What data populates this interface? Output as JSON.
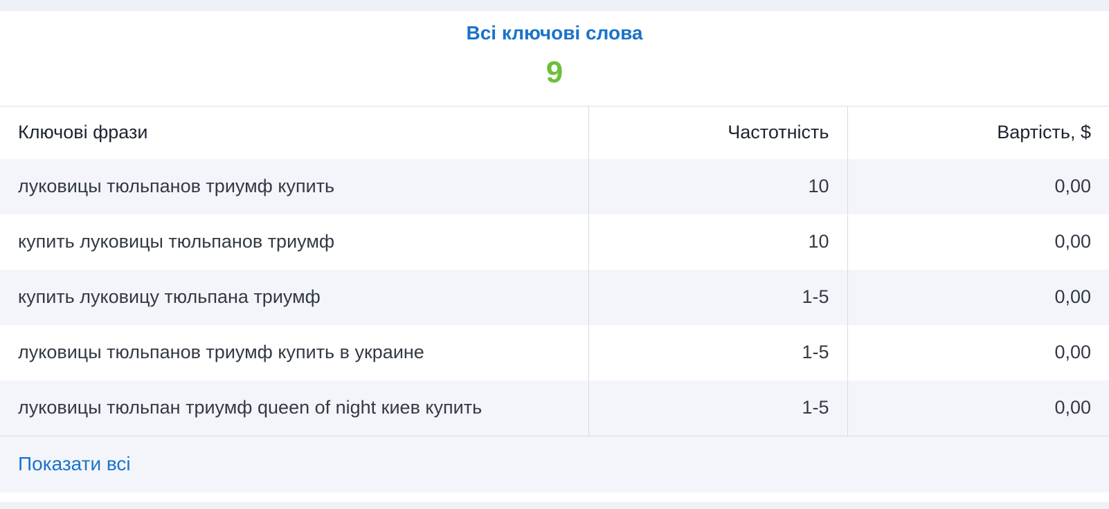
{
  "summary": {
    "title": "Всі ключові слова",
    "count": "9"
  },
  "table": {
    "headers": {
      "phrase": "Ключові фрази",
      "frequency": "Частотність",
      "cost": "Вартість, $"
    },
    "rows": [
      {
        "phrase": "луковицы тюльпанов триумф купить",
        "frequency": "10",
        "cost": "0,00"
      },
      {
        "phrase": "купить луковицы тюльпанов триумф",
        "frequency": "10",
        "cost": "0,00"
      },
      {
        "phrase": "купить луковицу тюльпана триумф",
        "frequency": "1-5",
        "cost": "0,00"
      },
      {
        "phrase": "луковицы тюльпанов триумф купить в украине",
        "frequency": "1-5",
        "cost": "0,00"
      },
      {
        "phrase": "луковицы тюльпан триумф queen of night киев купить",
        "frequency": "1-5",
        "cost": "0,00"
      }
    ]
  },
  "footer": {
    "show_all": "Показати всі"
  },
  "colors": {
    "link": "#1a73c8",
    "count": "#6cbf3a",
    "stripe": "#f3f5fa"
  }
}
